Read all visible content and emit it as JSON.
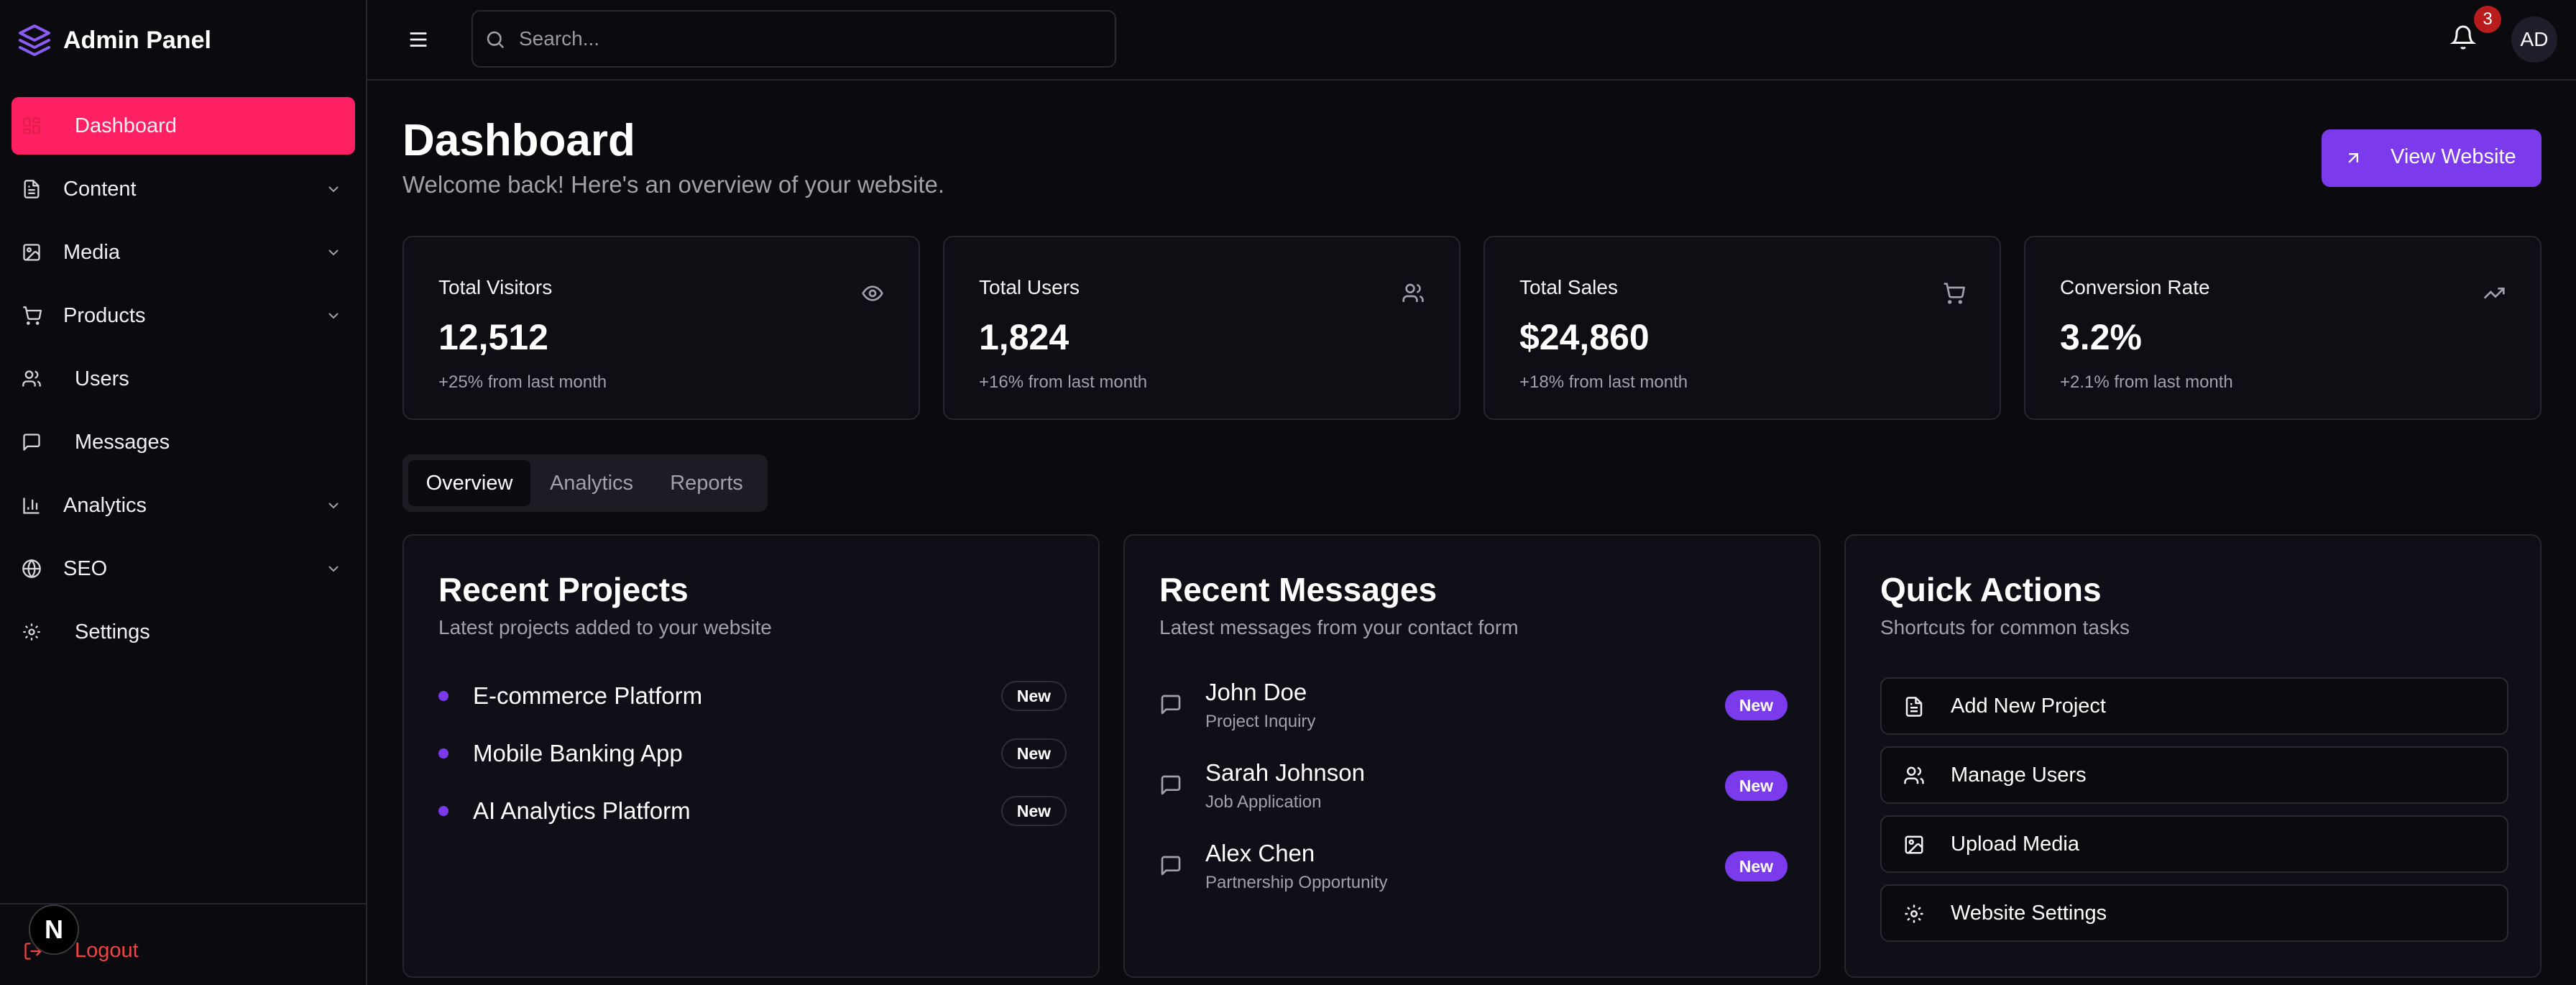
{
  "brand": {
    "title": "Admin Panel",
    "icon": "layers-icon"
  },
  "sidebar": {
    "items": [
      {
        "label": "Dashboard",
        "icon": "layout-dashboard-icon",
        "active": true,
        "expandable": false
      },
      {
        "label": "Content",
        "icon": "file-text-icon",
        "expandable": true
      },
      {
        "label": "Media",
        "icon": "image-icon",
        "expandable": true
      },
      {
        "label": "Products",
        "icon": "shopping-cart-icon",
        "expandable": true
      },
      {
        "label": "Users",
        "icon": "users-icon",
        "expandable": false
      },
      {
        "label": "Messages",
        "icon": "message-square-icon",
        "expandable": false
      },
      {
        "label": "Analytics",
        "icon": "bar-chart-icon",
        "expandable": true
      },
      {
        "label": "SEO",
        "icon": "globe-icon",
        "expandable": true
      },
      {
        "label": "Settings",
        "icon": "settings-icon",
        "expandable": false
      }
    ],
    "logout_label": "Logout"
  },
  "header": {
    "search_placeholder": "Search...",
    "notification_count": "3",
    "avatar_initials": "AD"
  },
  "dev_badge": "N",
  "page": {
    "title": "Dashboard",
    "subtitle": "Welcome back! Here's an overview of your website.",
    "view_website_label": "View Website"
  },
  "stats": [
    {
      "label": "Total Visitors",
      "value": "12,512",
      "change": "+25% from last month",
      "icon": "eye-icon"
    },
    {
      "label": "Total Users",
      "value": "1,824",
      "change": "+16% from last month",
      "icon": "users-icon"
    },
    {
      "label": "Total Sales",
      "value": "$24,860",
      "change": "+18% from last month",
      "icon": "shopping-cart-icon"
    },
    {
      "label": "Conversion Rate",
      "value": "3.2%",
      "change": "+2.1% from last month",
      "icon": "trending-up-icon"
    }
  ],
  "tabs": [
    {
      "label": "Overview",
      "active": true
    },
    {
      "label": "Analytics",
      "active": false
    },
    {
      "label": "Reports",
      "active": false
    }
  ],
  "recent_projects": {
    "title": "Recent Projects",
    "subtitle": "Latest projects added to your website",
    "items": [
      {
        "name": "E-commerce Platform",
        "badge": "New"
      },
      {
        "name": "Mobile Banking App",
        "badge": "New"
      },
      {
        "name": "AI Analytics Platform",
        "badge": "New"
      }
    ]
  },
  "recent_messages": {
    "title": "Recent Messages",
    "subtitle": "Latest messages from your contact form",
    "items": [
      {
        "name": "John Doe",
        "subject": "Project Inquiry",
        "badge": "New"
      },
      {
        "name": "Sarah Johnson",
        "subject": "Job Application",
        "badge": "New"
      },
      {
        "name": "Alex Chen",
        "subject": "Partnership Opportunity",
        "badge": "New"
      }
    ]
  },
  "quick_actions": {
    "title": "Quick Actions",
    "subtitle": "Shortcuts for common tasks",
    "items": [
      {
        "label": "Add New Project",
        "icon": "file-text-icon"
      },
      {
        "label": "Manage Users",
        "icon": "users-icon"
      },
      {
        "label": "Upload Media",
        "icon": "image-icon"
      },
      {
        "label": "Website Settings",
        "icon": "settings-icon"
      }
    ]
  },
  "colors": {
    "background": "#0a0a0f",
    "active_nav": "#ff1f63",
    "accent": "#7c3aed",
    "danger": "#ef4444"
  }
}
